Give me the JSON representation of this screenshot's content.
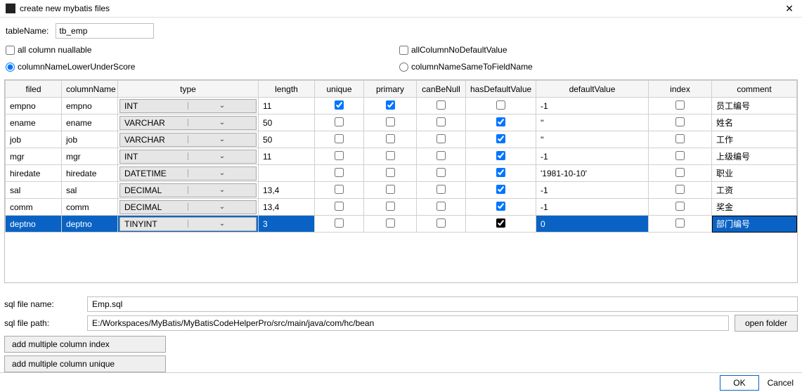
{
  "window": {
    "title": "create new mybatis files"
  },
  "form": {
    "tableNameLabel": "tableName:",
    "tableName": "tb_emp",
    "allColumnNullable": "all column nuallable",
    "allColumnNoDefault": "allColumnNoDefaultValue",
    "colNameLower": "columnNameLowerUnderScore",
    "colNameSame": "columnNameSameToFieldName"
  },
  "headers": {
    "filed": "filed",
    "columnName": "columnName",
    "type": "type",
    "length": "length",
    "unique": "unique",
    "primary": "primary",
    "canBeNull": "canBeNull",
    "hasDefaultValue": "hasDefaultValue",
    "defaultValue": "defaultValue",
    "index": "index",
    "comment": "comment"
  },
  "rows": [
    {
      "filed": "empno",
      "col": "empno",
      "type": "INT",
      "len": "11",
      "uniq": true,
      "prim": true,
      "null": false,
      "hasdef": false,
      "defv": "-1",
      "idx": false,
      "comment": "员工编号",
      "sel": false
    },
    {
      "filed": "ename",
      "col": "ename",
      "type": "VARCHAR",
      "len": "50",
      "uniq": false,
      "prim": false,
      "null": false,
      "hasdef": true,
      "defv": "''",
      "idx": false,
      "comment": "姓名",
      "sel": false
    },
    {
      "filed": "job",
      "col": "job",
      "type": "VARCHAR",
      "len": "50",
      "uniq": false,
      "prim": false,
      "null": false,
      "hasdef": true,
      "defv": "''",
      "idx": false,
      "comment": "工作",
      "sel": false
    },
    {
      "filed": "mgr",
      "col": "mgr",
      "type": "INT",
      "len": "11",
      "uniq": false,
      "prim": false,
      "null": false,
      "hasdef": true,
      "defv": "-1",
      "idx": false,
      "comment": "上级编号",
      "sel": false
    },
    {
      "filed": "hiredate",
      "col": "hiredate",
      "type": "DATETIME",
      "len": "",
      "uniq": false,
      "prim": false,
      "null": false,
      "hasdef": true,
      "defv": "'1981-10-10'",
      "idx": false,
      "comment": "职业",
      "sel": false
    },
    {
      "filed": "sal",
      "col": "sal",
      "type": "DECIMAL",
      "len": "13,4",
      "uniq": false,
      "prim": false,
      "null": false,
      "hasdef": true,
      "defv": "-1",
      "idx": false,
      "comment": "工资",
      "sel": false
    },
    {
      "filed": "comm",
      "col": "comm",
      "type": "DECIMAL",
      "len": "13,4",
      "uniq": false,
      "prim": false,
      "null": false,
      "hasdef": true,
      "defv": "-1",
      "idx": false,
      "comment": "奖金",
      "sel": false
    },
    {
      "filed": "deptno",
      "col": "deptno",
      "type": "TINYINT",
      "len": "3",
      "uniq": false,
      "prim": false,
      "null": false,
      "hasdef": true,
      "defv": "0",
      "idx": false,
      "comment": "部门编号",
      "sel": true
    }
  ],
  "bottom": {
    "sqlFileNameLabel": "sql file name:",
    "sqlFileName": "Emp.sql",
    "sqlFilePathLabel": "sql file path:",
    "sqlFilePath": "E:/Workspaces/MyBatis/MyBatisCodeHelperPro/src/main/java/com/hc/bean",
    "openFolder": "open folder",
    "addIndex": "add multiple column index",
    "addUnique": "add multiple column unique"
  },
  "footer": {
    "ok": "OK",
    "cancel": "Cancel"
  }
}
